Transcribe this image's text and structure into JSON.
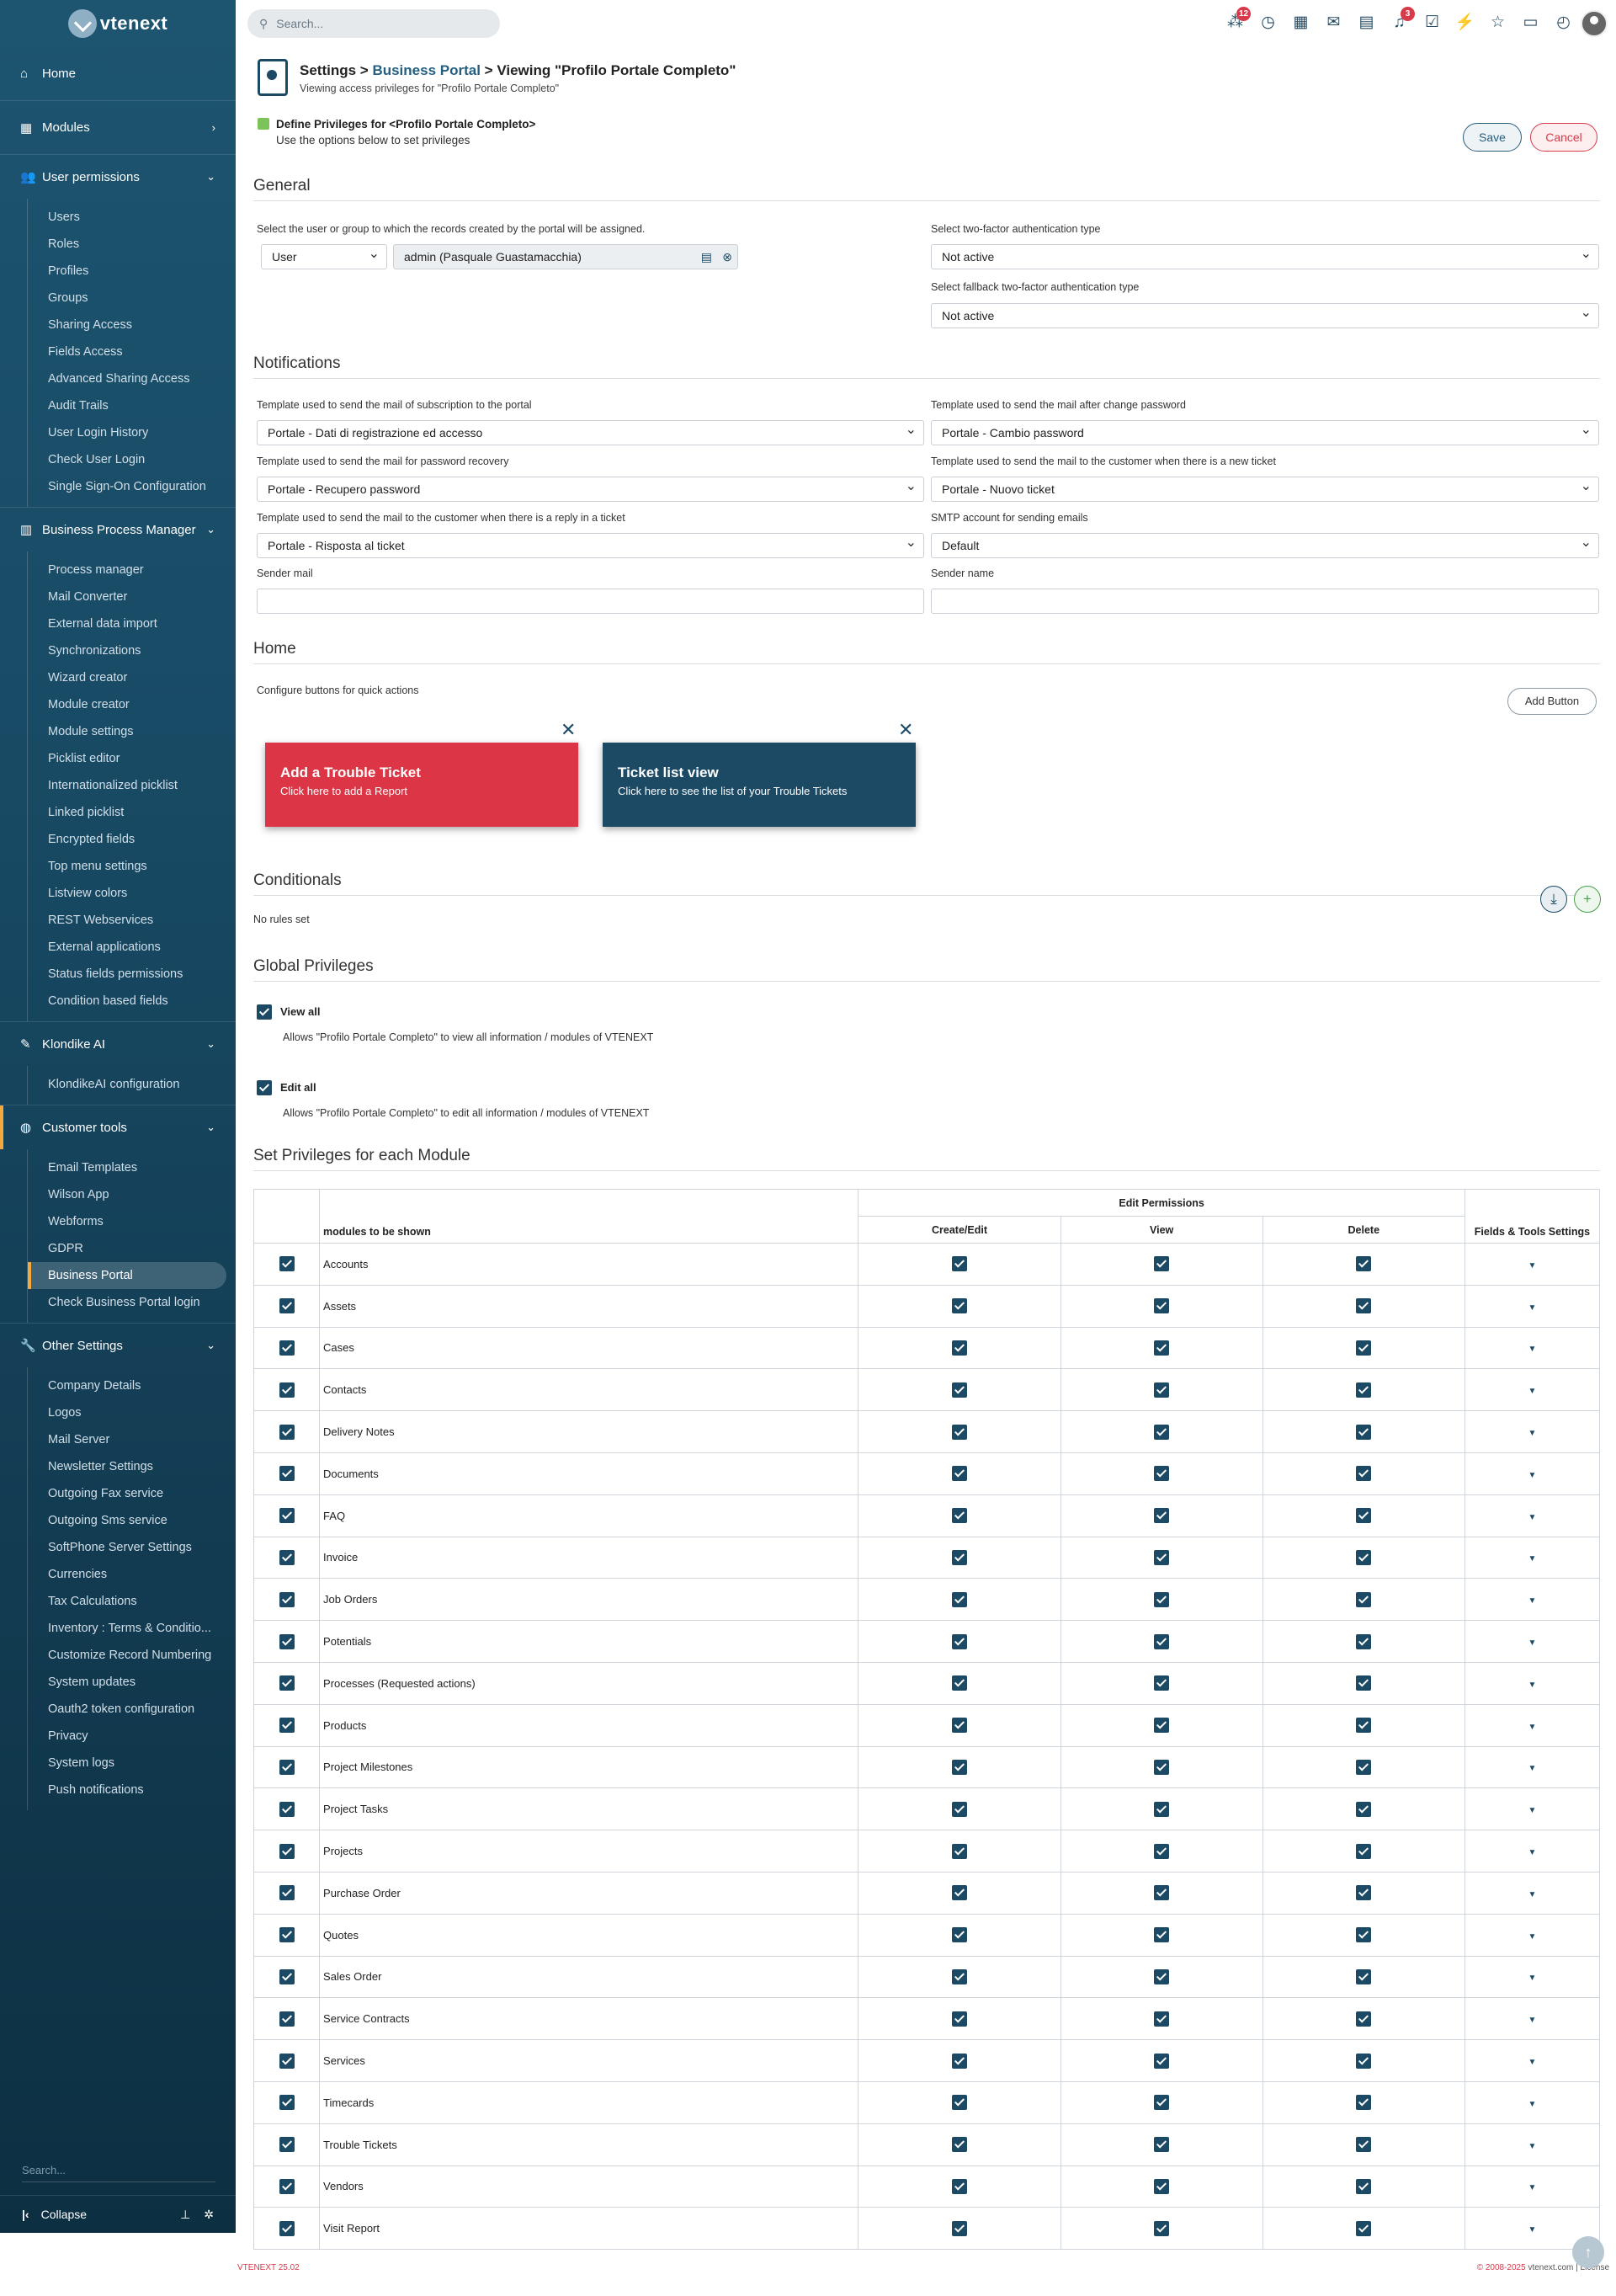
{
  "brand": "vtenext",
  "search_placeholder": "Search...",
  "top_icons": [
    {
      "name": "nodes-icon",
      "glyph": "⁂",
      "badge": "12"
    },
    {
      "name": "history-icon",
      "glyph": "◷",
      "badge": ""
    },
    {
      "name": "calendar-icon",
      "glyph": "▦",
      "badge": ""
    },
    {
      "name": "mail-icon",
      "glyph": "✉",
      "badge": ""
    },
    {
      "name": "chat-icon",
      "glyph": "▤",
      "badge": ""
    },
    {
      "name": "bell-icon",
      "glyph": "♫",
      "badge": "3"
    },
    {
      "name": "tasks-icon",
      "glyph": "☑",
      "badge": ""
    },
    {
      "name": "flash-icon",
      "glyph": "⚡",
      "badge": ""
    },
    {
      "name": "star-icon",
      "glyph": "☆",
      "badge": ""
    },
    {
      "name": "document-icon",
      "glyph": "▭",
      "badge": ""
    },
    {
      "name": "timer-icon",
      "glyph": "◴",
      "badge": ""
    }
  ],
  "sidebar": {
    "home": "Home",
    "modules": "Modules",
    "sections": [
      {
        "label": "User permissions",
        "icon": "users-icon",
        "items": [
          "Users",
          "Roles",
          "Profiles",
          "Groups",
          "Sharing Access",
          "Fields Access",
          "Advanced Sharing Access",
          "Audit Trails",
          "User Login History",
          "Check User Login",
          "Single Sign-On Configuration"
        ]
      },
      {
        "label": "Business Process Manager",
        "icon": "flow-icon",
        "items": [
          "Process manager",
          "Mail Converter",
          "External data import",
          "Synchronizations",
          "Wizard creator",
          "Module creator",
          "Module settings",
          "Picklist editor",
          "Internationalized picklist",
          "Linked picklist",
          "Encrypted fields",
          "Top menu settings",
          "Listview colors",
          "REST Webservices",
          "External applications",
          "Status fields permissions",
          "Condition based fields"
        ]
      },
      {
        "label": "Klondike AI",
        "icon": "ai-icon",
        "items": [
          "KlondikeAI configuration"
        ]
      },
      {
        "label": "Customer tools",
        "icon": "globe-icon",
        "items": [
          "Email Templates",
          "Wilson App",
          "Webforms",
          "GDPR",
          "Business Portal",
          "Check Business Portal login"
        ]
      },
      {
        "label": "Other Settings",
        "icon": "wrench-icon",
        "items": [
          "Company Details",
          "Logos",
          "Mail Server",
          "Newsletter Settings",
          "Outgoing Fax service",
          "Outgoing Sms service",
          "SoftPhone Server Settings",
          "Currencies",
          "Tax Calculations",
          "Inventory : Terms & Conditio...",
          "Customize Record Numbering",
          "System updates",
          "Oauth2 token configuration",
          "Privacy",
          "System logs",
          "Push notifications"
        ]
      }
    ],
    "active_item": "Business Portal",
    "search": "Search...",
    "collapse": "Collapse"
  },
  "header": {
    "crumb_settings": "Settings",
    "crumb_sep": " > ",
    "crumb_portal": "Business Portal",
    "crumb_view": "Viewing \"Profilo Portale Completo\"",
    "subtitle": "Viewing access privileges for \"Profilo Portale Completo\"",
    "define": "Define Privileges for <Profilo Portale Completo>",
    "define_sub": "Use the options below to set privileges",
    "save": "Save",
    "cancel": "Cancel"
  },
  "general": {
    "title": "General",
    "assign_label": "Select the user or group to which the records created by the portal will be assigned.",
    "assign_type": "User",
    "assign_value": "admin (Pasquale Guastamacchia)",
    "twofa_label": "Select two-factor authentication type",
    "twofa_value": "Not active",
    "fallback_label": "Select fallback two-factor authentication type",
    "fallback_value": "Not active"
  },
  "notifications": {
    "title": "Notifications",
    "sub_label": "Template used to send the mail of subscription to the portal",
    "sub_value": "Portale - Dati di registrazione ed accesso",
    "chg_label": "Template used to send the mail after change password",
    "chg_value": "Portale - Cambio password",
    "rec_label": "Template used to send the mail for password recovery",
    "rec_value": "Portale - Recupero password",
    "new_label": "Template used to send the mail to the customer when there is a new ticket",
    "new_value": "Portale - Nuovo ticket",
    "reply_label": "Template used to send the mail to the customer when there is a reply in a ticket",
    "reply_value": "Portale - Risposta al ticket",
    "smtp_label": "SMTP account for sending emails",
    "smtp_value": "Default",
    "sender_mail_label": "Sender mail",
    "sender_mail_value": "",
    "sender_name_label": "Sender name",
    "sender_name_value": ""
  },
  "home": {
    "title": "Home",
    "configure": "Configure buttons for quick actions",
    "add_button": "Add Button",
    "buttons": [
      {
        "title": "Add a Trouble Ticket",
        "desc": "Click here to add a Report",
        "color": "#dc3545"
      },
      {
        "title": "Ticket list view",
        "desc": "Click here to see the list of your Trouble Tickets",
        "color": "#1c4a64"
      }
    ]
  },
  "conditionals": {
    "title": "Conditionals",
    "empty": "No rules set"
  },
  "global": {
    "title": "Global Privileges",
    "view_all": "View all",
    "view_all_desc": "Allows \"Profilo Portale Completo\" to view all information / modules of VTENEXT",
    "edit_all": "Edit all",
    "edit_all_desc": "Allows \"Profilo Portale Completo\" to edit all information / modules of VTENEXT"
  },
  "modules": {
    "title": "Set Privileges for each Module",
    "h_edit": "Edit Permissions",
    "h_modules": "modules to be shown",
    "h_create": "Create/Edit",
    "h_view": "View",
    "h_delete": "Delete",
    "h_fields": "Fields & Tools Settings",
    "rows": [
      "Accounts",
      "Assets",
      "Cases",
      "Contacts",
      "Delivery Notes",
      "Documents",
      "FAQ",
      "Invoice",
      "Job Orders",
      "Potentials",
      "Processes (Requested actions)",
      "Products",
      "Project Milestones",
      "Project Tasks",
      "Projects",
      "Purchase Order",
      "Quotes",
      "Sales Order",
      "Service Contracts",
      "Services",
      "Timecards",
      "Trouble Tickets",
      "Vendors",
      "Visit Report"
    ]
  },
  "footer": {
    "version": "VTENEXT 25.02",
    "copyright": "© 2008-2025",
    "site": "vtenext.com",
    "license": "License"
  }
}
